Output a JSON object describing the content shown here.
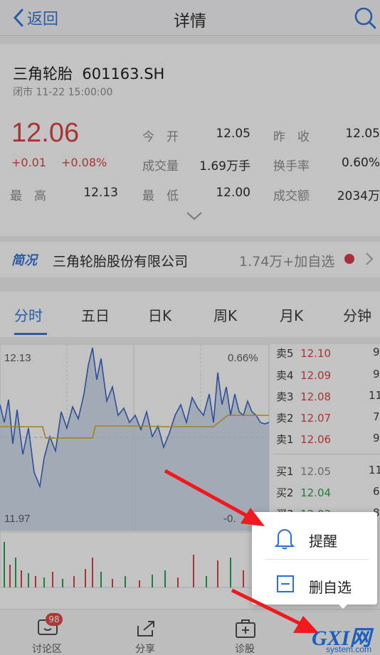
{
  "nav": {
    "back_label": "返回",
    "title": "详情"
  },
  "stock": {
    "name": "三角轮胎",
    "code": "601163.SH",
    "status": "闭市 11-22 15:00:00",
    "price": "12.06",
    "change": "+0.01",
    "change_pct": "+0.08%",
    "stats": [
      {
        "label": "今　开",
        "value": "12.05"
      },
      {
        "label": "昨　收",
        "value": "12.05"
      },
      {
        "label": "成交量",
        "value": "1.69万手"
      },
      {
        "label": "换手率",
        "value": "0.60%"
      },
      {
        "label": "最　高",
        "value": "12.13"
      },
      {
        "label": "最　低",
        "value": "12.00"
      },
      {
        "label": "成交额",
        "value": "2034万"
      }
    ]
  },
  "company": {
    "brief_label": "简况",
    "name": "三角轮胎股份有限公司",
    "followers": "1.74万+加自选"
  },
  "tabs": [
    "分时",
    "五日",
    "日K",
    "周K",
    "月K",
    "分钟"
  ],
  "chart": {
    "y_max": "12.13",
    "y_min": "11.97",
    "pct_max": "0.66%",
    "pct_min": "-0."
  },
  "order_book": {
    "sell": [
      {
        "label": "卖5",
        "price": "12.10",
        "vol": "9"
      },
      {
        "label": "卖4",
        "price": "12.09",
        "vol": "9"
      },
      {
        "label": "卖3",
        "price": "12.08",
        "vol": "11"
      },
      {
        "label": "卖2",
        "price": "12.07",
        "vol": "7"
      },
      {
        "label": "卖1",
        "price": "12.06",
        "vol": "9"
      }
    ],
    "buy": [
      {
        "label": "买1",
        "price": "12.05",
        "vol": "11"
      },
      {
        "label": "买2",
        "price": "12.04",
        "vol": "6"
      },
      {
        "label": "买3",
        "price": "12.03",
        "vol": "8"
      }
    ]
  },
  "toolbar": {
    "items": [
      {
        "label": "讨论区",
        "icon": "chat-icon"
      },
      {
        "label": "分享",
        "icon": "share-icon"
      },
      {
        "label": "诊股",
        "icon": "diagnose-icon"
      }
    ],
    "badge": "98"
  },
  "popup": {
    "remind_label": "提醒",
    "remove_label": "删自选"
  },
  "watermark": {
    "text_main": "GXI网",
    "text_sub": "system.com"
  },
  "colors": {
    "accent": "#2c6fd6",
    "up": "#d93b3b",
    "down": "#1e9e4a"
  }
}
